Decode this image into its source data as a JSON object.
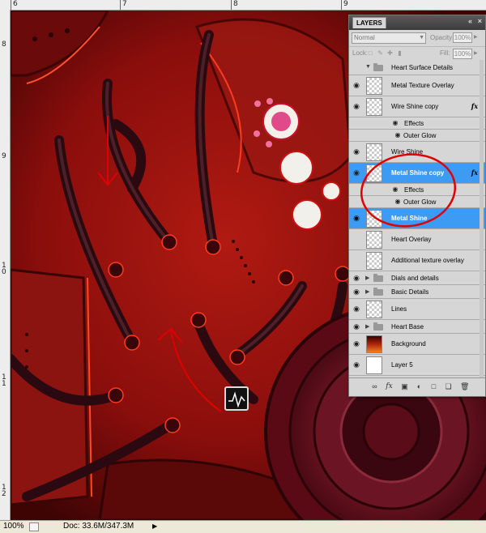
{
  "rulers": {
    "top": [
      "6",
      "7",
      "8",
      "9"
    ],
    "left": [
      "8",
      "9",
      "1\n0",
      "1\n1",
      "1\n2"
    ]
  },
  "layers_panel": {
    "tab_label": "LAYERS",
    "blend_mode": "Normal",
    "opacity_label": "Opacity:",
    "opacity_value": "100%",
    "lock_label": "Lock:",
    "fill_label": "Fill:",
    "fill_value": "100%",
    "layers": [
      {
        "name": "Heart Surface Details",
        "type": "group"
      },
      {
        "name": "Metal Texture Overlay",
        "type": "layer"
      },
      {
        "name": "Wire Shine copy",
        "type": "layer",
        "fx": "fx"
      },
      {
        "name": "Effects",
        "type": "effects"
      },
      {
        "name": "Outer Glow",
        "type": "effect"
      },
      {
        "name": "Wire Shine",
        "type": "layer"
      },
      {
        "name": "Metal Shine copy",
        "type": "layer",
        "fx": "fx",
        "selected": true
      },
      {
        "name": "Effects",
        "type": "effects",
        "selected": true
      },
      {
        "name": "Outer Glow",
        "type": "effect",
        "selected": true
      },
      {
        "name": "Metal Shine",
        "type": "layer",
        "selected": true
      },
      {
        "name": "Heart Overlay",
        "type": "layer"
      },
      {
        "name": "Additional texture overlay",
        "type": "layer"
      },
      {
        "name": "Dials and details",
        "type": "group"
      },
      {
        "name": "Basic Details",
        "type": "group"
      },
      {
        "name": "Lines",
        "type": "layer"
      },
      {
        "name": "Heart Base",
        "type": "group"
      },
      {
        "name": "Background",
        "type": "layer",
        "thumb": "fire"
      },
      {
        "name": "Layer 5",
        "type": "layer",
        "thumb": "white"
      }
    ],
    "effect_glyph": "fx"
  },
  "status_bar": {
    "zoom": "100%",
    "doc_info": "Doc: 33.6M/347.3M"
  },
  "colors": {
    "canvas_red": "#7a0a0a",
    "selection_blue": "#3d9bf3",
    "annotation_red": "#e00000"
  }
}
